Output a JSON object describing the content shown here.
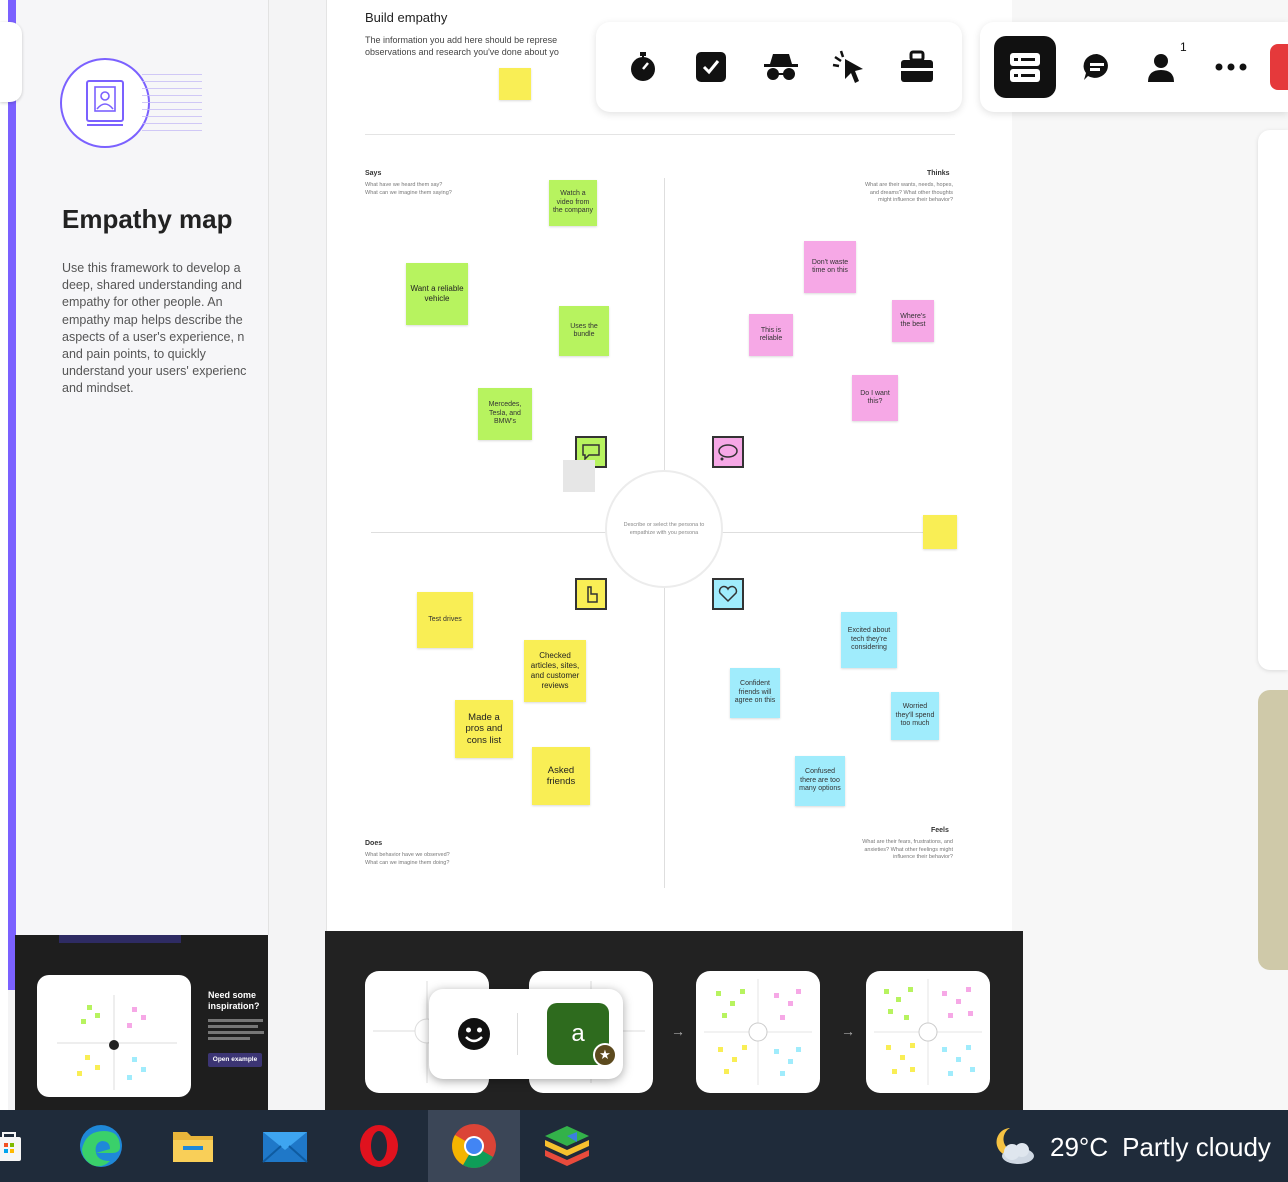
{
  "template_panel": {
    "title": "Empathy map",
    "description": "Use this framework to develop a\ndeep, shared understanding and\nempathy for other people. An\nempathy map helps describe the\naspects of a user's experience, n\nand pain points, to quickly\nunderstand your users' experienc\nand mindset."
  },
  "inspiration": {
    "heading": "Need some inspiration?",
    "button": "Open example"
  },
  "board": {
    "title": "Build empathy",
    "subtitle": "The information you add here should be represe\nobservations and research you've done about yo",
    "quadrants": {
      "says": {
        "label": "Says",
        "desc": "What have we heard them say?\nWhat can we imagine them saying?"
      },
      "thinks": {
        "label": "Thinks",
        "desc": "What are their wants, needs, hopes,\nand dreams? What other thoughts\nmight influence their behavior?"
      },
      "does": {
        "label": "Does",
        "desc": "What behavior have we observed?\nWhat can we imagine them doing?"
      },
      "feels": {
        "label": "Feels",
        "desc": "What are their fears, frustrations, and\nanxieties? What other feelings might\ninfluence their behavior?"
      }
    },
    "center_text": "Describe or select the persona to empathize with you persona",
    "says_notes": [
      "Watch a video from the company",
      "Want a reliable vehicle",
      "Uses the bundle",
      "Mercedes, Tesla, and BMW's"
    ],
    "thinks_notes": [
      "Don't waste time on this",
      "This is reliable",
      "Where's the best",
      "Do I want this?"
    ],
    "does_notes": [
      "Test drives",
      "Checked articles, sites, and customer reviews",
      "Made a pros and cons list",
      "Asked friends"
    ],
    "feels_notes": [
      "Excited about tech they're considering",
      "Worried they'll spend too much",
      "Confident friends will agree on this",
      "Confused there are too many options"
    ]
  },
  "toolbar_left": [
    "stopwatch-icon",
    "checkbox-icon",
    "spy-icon",
    "cursor-click-icon",
    "toolbox-icon"
  ],
  "toolbar_right": {
    "collaborators_count": "1"
  },
  "bottom_panel": {
    "avatar_letter": "a"
  },
  "taskbar": {
    "apps": [
      "store-icon",
      "edge-icon",
      "file-explorer-icon",
      "mail-icon",
      "opera-icon",
      "chrome-icon",
      "bluestacks-icon"
    ],
    "weather_temp": "29°C",
    "weather_desc": "Partly cloudy"
  }
}
